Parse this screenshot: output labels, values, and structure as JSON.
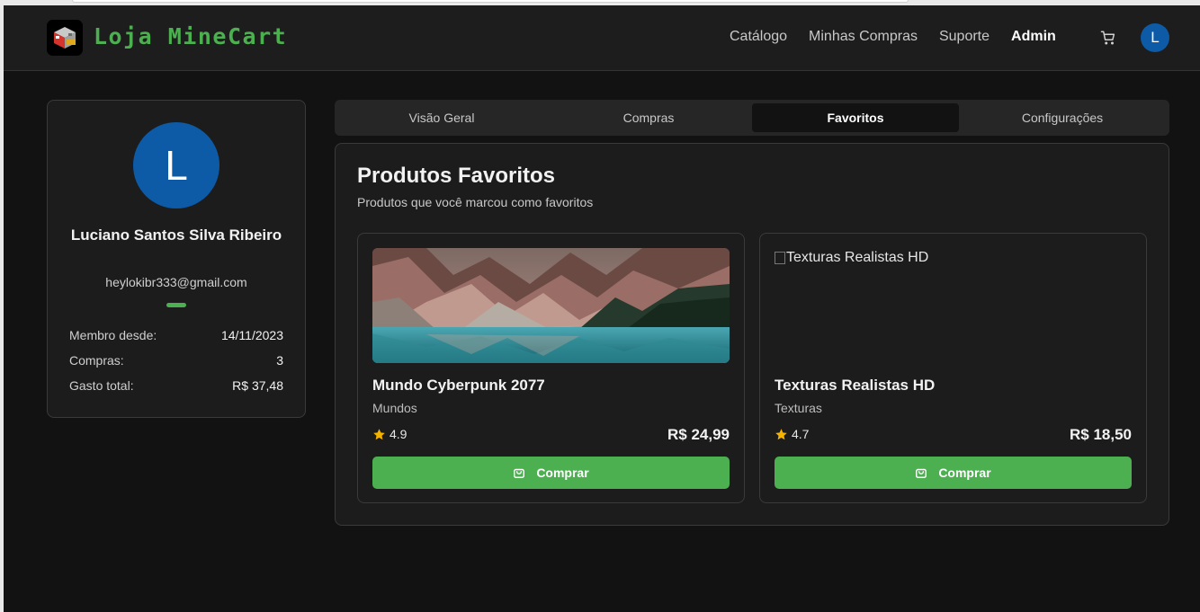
{
  "header": {
    "brand": "Loja MineCart",
    "nav": [
      "Catálogo",
      "Minhas Compras",
      "Suporte",
      "Admin"
    ],
    "avatar_letter": "L",
    "icons": {
      "logo": "minecraft-block-logo-icon",
      "cart": "shopping-cart-icon"
    }
  },
  "profile": {
    "avatar_letter": "L",
    "name": "Luciano Santos Silva Ribeiro",
    "email": "heylokibr333@gmail.com",
    "stats": [
      {
        "label": "Membro desde:",
        "value": "14/11/2023"
      },
      {
        "label": "Compras:",
        "value": "3"
      },
      {
        "label": "Gasto total:",
        "value": "R$ 37,48"
      }
    ]
  },
  "tabs": [
    {
      "label": "Visão Geral",
      "active": false
    },
    {
      "label": "Compras",
      "active": false
    },
    {
      "label": "Favoritos",
      "active": true
    },
    {
      "label": "Configurações",
      "active": false
    }
  ],
  "favorites": {
    "title": "Produtos Favoritos",
    "subtitle": "Produtos que você marcou como favoritos",
    "products": [
      {
        "image": "mountain-lake-photo",
        "name": "Mundo Cyberpunk 2077",
        "category": "Mundos",
        "rating": "4.9",
        "price": "R$ 24,99",
        "button": "Comprar"
      },
      {
        "image_alt": "Texturas Realistas HD",
        "name": "Texturas Realistas HD",
        "category": "Texturas",
        "rating": "4.7",
        "price": "R$ 18,50",
        "button": "Comprar"
      }
    ]
  },
  "colors": {
    "accent": "#4caf50",
    "avatar": "#0d5aa7",
    "star": "#f5b301",
    "background": "#121212"
  }
}
